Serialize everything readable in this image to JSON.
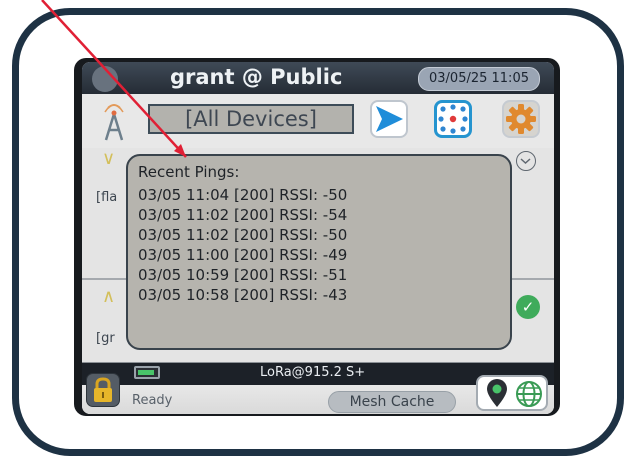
{
  "header": {
    "user_title": "grant @ Public",
    "datetime": "03/05/25 11:05"
  },
  "toolbar": {
    "device_filter": "[All Devices]"
  },
  "list": {
    "row1_fragment": "[fla",
    "row2_fragment": "[gr"
  },
  "popup": {
    "title": "Recent Pings:",
    "pings": [
      "03/05 11:04 [200] RSSI: -50",
      "03/05 11:02 [200] RSSI: -54",
      "03/05 11:02 [200] RSSI: -50",
      "03/05 11:00 [200] RSSI: -49",
      "03/05 10:59 [200] RSSI: -51",
      "03/05 10:58 [200] RSSI: -43"
    ]
  },
  "status": {
    "radio": "LoRa@915.2 S+",
    "state": "Ready",
    "cache_label": "Mesh Cache"
  },
  "colors": {
    "frame": "#1e3244",
    "arrow": "#e02035",
    "accent_blue": "#2594cf",
    "ok_green": "#3fab5b"
  }
}
